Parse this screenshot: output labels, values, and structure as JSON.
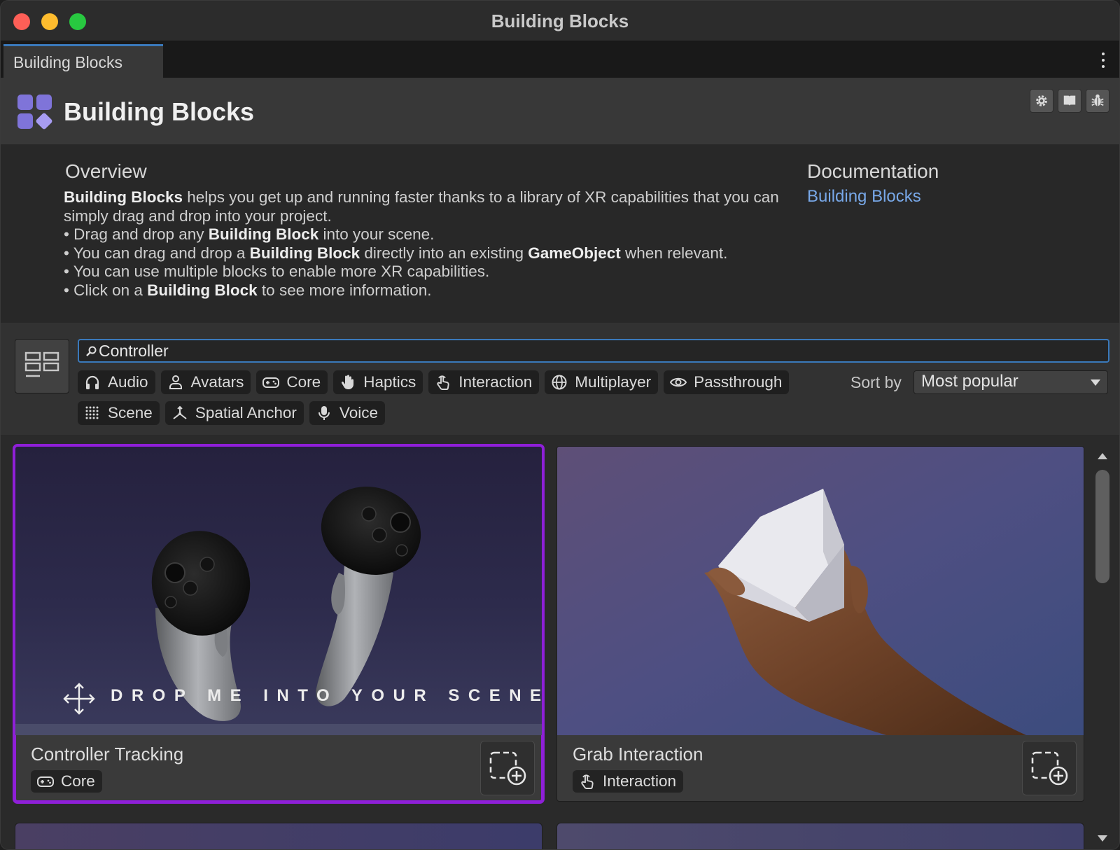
{
  "window": {
    "title": "Building Blocks"
  },
  "tab": {
    "label": "Building Blocks"
  },
  "header": {
    "title": "Building Blocks",
    "icons": [
      "gear-icon",
      "book-icon",
      "bug-icon"
    ]
  },
  "overview": {
    "title": "Overview",
    "intro": {
      "bold": "Building Blocks",
      "rest": " helps you get up and running faster thanks to a library of XR capabilities that you can simply drag and drop into your project."
    },
    "bullets": [
      {
        "pre": "• Drag and drop any ",
        "bold": "Building Block",
        "mid": " into your scene.",
        "bold2": "",
        "post": ""
      },
      {
        "pre": "• You can drag and drop a ",
        "bold": "Building Block",
        "mid": " directly into an existing ",
        "bold2": "GameObject",
        "post": " when relevant."
      },
      {
        "pre": "• You can use multiple blocks to enable more XR capabilities.",
        "bold": "",
        "mid": "",
        "bold2": "",
        "post": ""
      },
      {
        "pre": "• Click on a ",
        "bold": "Building Block",
        "mid": " to see more information.",
        "bold2": "",
        "post": ""
      }
    ]
  },
  "documentation": {
    "title": "Documentation",
    "link": "Building Blocks"
  },
  "search": {
    "value": "Controller",
    "placeholder": ""
  },
  "filters": {
    "row1": [
      {
        "label": "Audio",
        "icon": "headphones-icon"
      },
      {
        "label": "Avatars",
        "icon": "person-icon"
      },
      {
        "label": "Core",
        "icon": "gamepad-icon"
      },
      {
        "label": "Haptics",
        "icon": "hand-icon"
      },
      {
        "label": "Interaction",
        "icon": "pointer-icon"
      },
      {
        "label": "Multiplayer",
        "icon": "globe-icon"
      },
      {
        "label": "Passthrough",
        "icon": "eye-icon"
      }
    ],
    "row2": [
      {
        "label": "Scene",
        "icon": "grid-dots-icon"
      },
      {
        "label": "Spatial Anchor",
        "icon": "anchor-axes-icon"
      },
      {
        "label": "Voice",
        "icon": "microphone-icon"
      }
    ]
  },
  "sort": {
    "label": "Sort by",
    "value": "Most popular"
  },
  "cards": [
    {
      "name": "Controller Tracking",
      "tag": "Core",
      "tag_icon": "gamepad-icon",
      "overlay": "DROP ME INTO YOUR SCENE",
      "selected": true
    },
    {
      "name": "Grab Interaction",
      "tag": "Interaction",
      "tag_icon": "pointer-icon",
      "selected": false
    }
  ],
  "colors": {
    "accent_blue": "#3a79bb",
    "link_blue": "#78a8e8",
    "selection_purple": "#8f1fd8",
    "logo_purple": "#7f74d9"
  }
}
